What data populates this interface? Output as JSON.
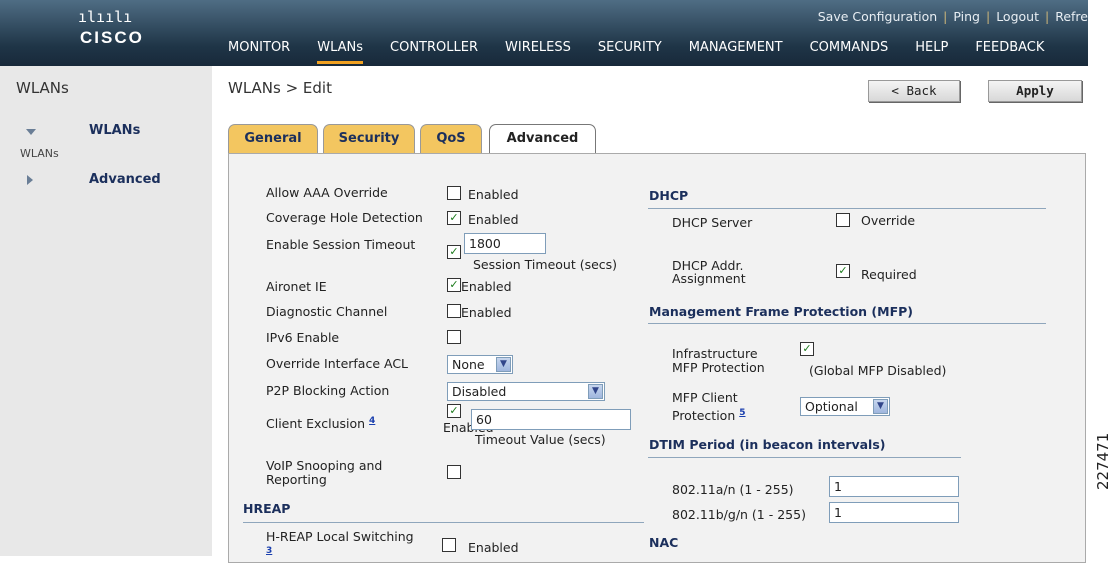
{
  "brand": {
    "logo_bars": "ılıılı",
    "logo_name": "CISCO"
  },
  "utility_links": [
    "Save Configuration",
    "Ping",
    "Logout",
    "Refre"
  ],
  "nav": [
    "MONITOR",
    "WLANs",
    "CONTROLLER",
    "WIRELESS",
    "SECURITY",
    "MANAGEMENT",
    "COMMANDS",
    "HELP",
    "FEEDBACK"
  ],
  "nav_active": "WLANs",
  "left": {
    "title": "WLANs",
    "tree": [
      {
        "label": "WLANs",
        "sub": "WLANs",
        "expanded": true
      },
      {
        "label": "Advanced",
        "expanded": false
      }
    ]
  },
  "page_title": "WLANs > Edit",
  "buttons": {
    "back": "< Back",
    "apply": "Apply"
  },
  "tabs": [
    "General",
    "Security",
    "QoS",
    "Advanced"
  ],
  "active_tab": "Advanced",
  "form": {
    "allow_aaa": {
      "label": "Allow AAA Override",
      "checked": false,
      "text": "Enabled"
    },
    "coverage_hole": {
      "label": "Coverage Hole Detection",
      "checked": true,
      "text": "Enabled"
    },
    "session_timeout": {
      "label": "Enable Session Timeout",
      "checked": true,
      "value": "1800",
      "hint": "Session Timeout (secs)"
    },
    "aironet": {
      "label": "Aironet IE",
      "checked": true,
      "text": "Enabled"
    },
    "diag_channel": {
      "label": "Diagnostic Channel",
      "checked": false,
      "text": "Enabled"
    },
    "ipv6": {
      "label": "IPv6 Enable",
      "checked": false
    },
    "override_acl": {
      "label": "Override Interface ACL",
      "value": "None"
    },
    "p2p": {
      "label": "P2P Blocking Action",
      "value": "Disabled"
    },
    "client_exclusion": {
      "label": "Client Exclusion",
      "footnote": "4",
      "checked": true,
      "text": "Enabled",
      "value": "60",
      "hint": "Timeout Value (secs)"
    },
    "voip": {
      "label_line1": "VoIP Snooping and",
      "label_line2": "Reporting",
      "checked": false
    },
    "hreap": {
      "header": "HREAP",
      "local_switching": {
        "label": "H-REAP Local Switching",
        "footnote": "3",
        "checked": false,
        "text": "Enabled"
      }
    },
    "dhcp": {
      "header": "DHCP",
      "server": {
        "label": "DHCP Server",
        "checked": false,
        "text": "Override"
      },
      "addr": {
        "label_line1": "DHCP Addr.",
        "label_line2": "Assignment",
        "checked": true,
        "text": "Required"
      }
    },
    "mfp": {
      "header": "Management Frame Protection (MFP)",
      "infra": {
        "label_line1": "Infrastructure",
        "label_line2": "MFP Protection",
        "checked": true,
        "note": "(Global MFP Disabled)"
      },
      "client": {
        "label_line1": "MFP Client",
        "label_line2": "Protection",
        "footnote": "5",
        "value": "Optional"
      }
    },
    "dtim": {
      "header": "DTIM Period (in beacon intervals)",
      "a": {
        "label": "802.11a/n (1 - 255)",
        "value": "1"
      },
      "b": {
        "label": "802.11b/g/n (1 - 255)",
        "value": "1"
      }
    },
    "nac": {
      "header": "NAC"
    }
  },
  "figure_id": "227471",
  "colors": {
    "nav_bg": "#1f3547",
    "tab_inactive": "#f3c660",
    "section_header": "#1b2f5c",
    "active_underline": "#f0a020"
  }
}
